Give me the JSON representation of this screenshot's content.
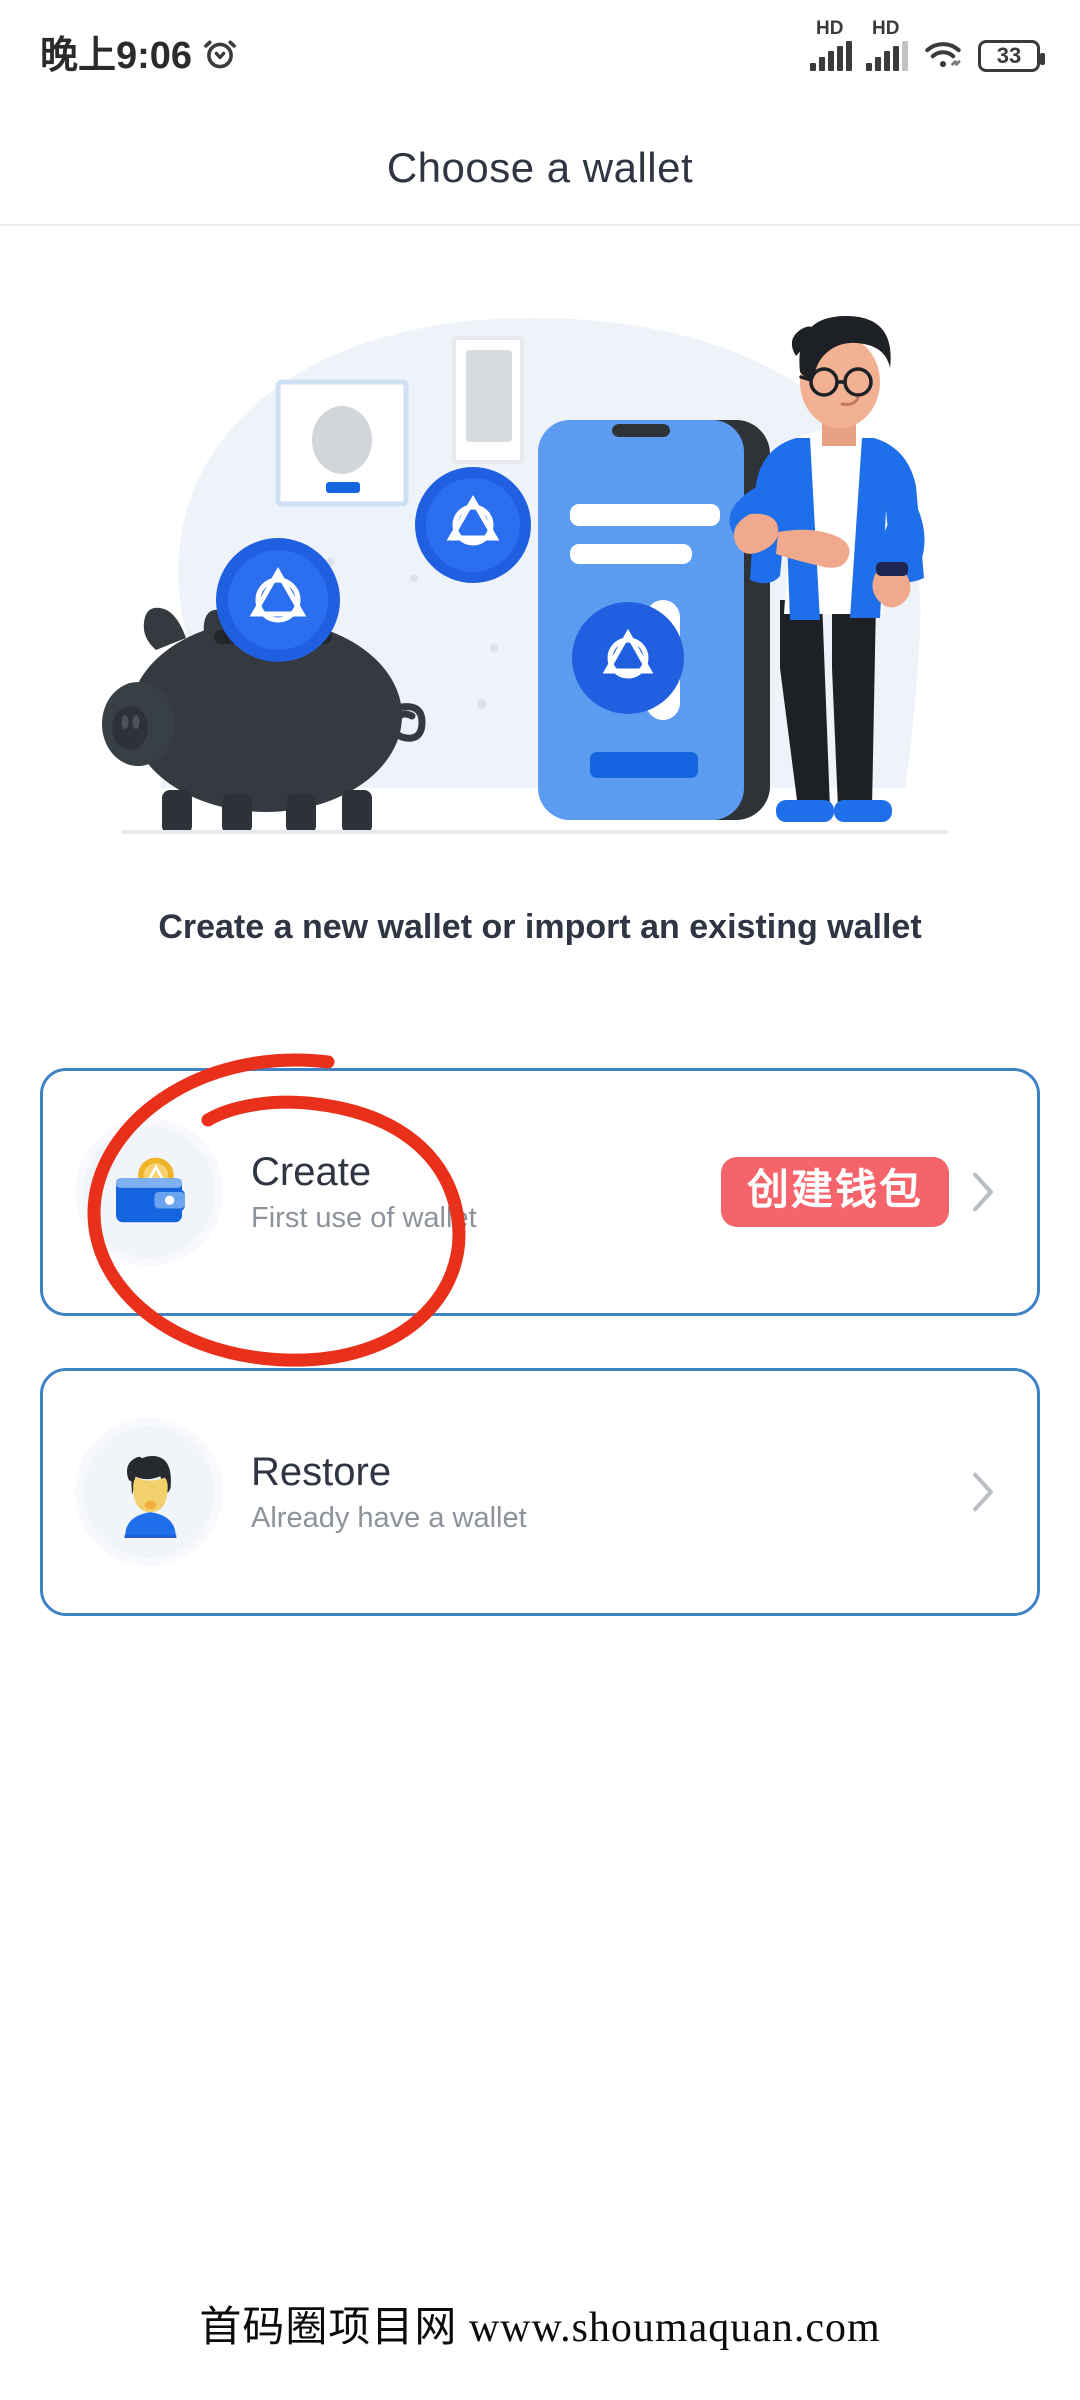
{
  "status_bar": {
    "clock": "晚上9:06",
    "alarm_icon": "alarm-clock-icon",
    "signal_label_1": "HD",
    "signal_label_2": "HD",
    "wifi_icon": "wifi-icon",
    "battery_level": "33"
  },
  "header": {
    "title": "Choose a wallet"
  },
  "hero": {
    "illustration_name": "wallet-onboarding-illustration",
    "alt": "Piggy bank with coins, smartphone and standing man"
  },
  "main": {
    "subtitle": "Create a new wallet or import an existing wallet",
    "options": [
      {
        "id": "create",
        "icon": "wallet-icon",
        "title": "Create",
        "subtitle": "First use of wallet",
        "badge": "创建钱包",
        "chevron": "chevron-right-icon"
      },
      {
        "id": "restore",
        "icon": "user-avatar-icon",
        "title": "Restore",
        "subtitle": "Already have a wallet",
        "badge": "",
        "chevron": "chevron-right-icon"
      }
    ]
  },
  "annotation": {
    "name": "red-circle-highlight",
    "target": "create",
    "color": "#e8301a"
  },
  "footer": {
    "watermark": "首码圈项目网 www.shoumaquan.com"
  },
  "colors": {
    "card_border": "#4083c4",
    "badge_bg": "#f4646a",
    "title_text": "#2f3542",
    "sub_text": "#8d939b",
    "accent_blue": "#1565e0",
    "annotation_red": "#e8301a"
  }
}
